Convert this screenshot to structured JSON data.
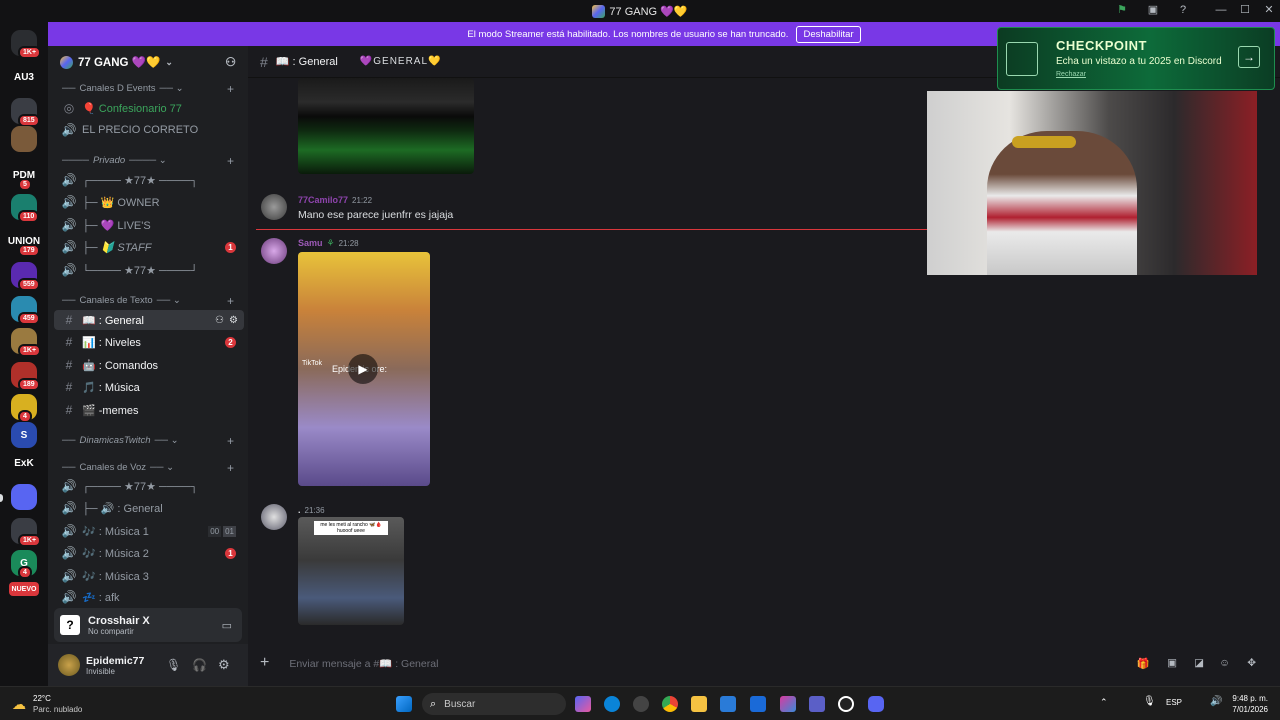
{
  "window": {
    "title": "77 GANG 💜💛"
  },
  "banner": {
    "text": "El modo Streamer está habilitado. Los nombres de usuario se han truncado.",
    "button": "Deshabilitar"
  },
  "servers": [
    {
      "label": "",
      "badge": "1K+",
      "color": "#2b2d31"
    },
    {
      "label": "AU3",
      "badge": "",
      "color": "#121214"
    },
    {
      "label": "",
      "badge": "815",
      "color": "#3a3d44"
    },
    {
      "label": "",
      "badge": "",
      "color": "#7a5a3a"
    },
    {
      "label": "PDM",
      "badge": "5",
      "color": "#121214"
    },
    {
      "label": "",
      "badge": "110",
      "color": "#1a7f6e"
    },
    {
      "label": "UNION",
      "badge": "179",
      "color": "#121214"
    },
    {
      "label": "",
      "badge": "559",
      "color": "#5a2ab0"
    },
    {
      "label": "",
      "badge": "459",
      "color": "#2a8bb0"
    },
    {
      "label": "",
      "badge": "1K+",
      "color": "#9a7a40"
    },
    {
      "label": "",
      "badge": "189",
      "color": "#b0302a"
    },
    {
      "label": "",
      "badge": "4",
      "color": "#d8b020"
    },
    {
      "label": "S",
      "badge": "",
      "color": "#2a4bb0"
    },
    {
      "label": "ExK",
      "badge": "",
      "color": "#121214"
    },
    {
      "label": "",
      "badge": "",
      "color": "#5865f2"
    },
    {
      "label": "",
      "badge": "1K+",
      "color": "#3a3d44"
    },
    {
      "label": "G",
      "badge": "4",
      "color": "#1a8a5a"
    },
    {
      "label": "NUEVO",
      "badge": "",
      "color": "#da373c"
    }
  ],
  "sidebar": {
    "server_name": "77 GANG 💜💛",
    "categories": [
      "Canales D Events",
      "Privado",
      "Canales de Texto",
      "DinamicasTwitch",
      "Canales de Voz"
    ],
    "channels": [
      {
        "icon": "◎",
        "label": "🎈 Confesionario 77",
        "badge": ""
      },
      {
        "icon": "🔊",
        "label": "EL PRECIO CORRETO",
        "badge": ""
      },
      {
        "icon": "🔊",
        "label": "┌──── ★77★ ────┐",
        "badge": ""
      },
      {
        "icon": "🔊",
        "label": "├─ 👑 OWNER",
        "badge": ""
      },
      {
        "icon": "🔊",
        "label": "├─ 💜 LIVE'S",
        "badge": ""
      },
      {
        "icon": "🔊",
        "label": "├─ 🔰 STAFF",
        "badge": "1"
      },
      {
        "icon": "🔊",
        "label": "└──── ★77★ ────┘",
        "badge": ""
      },
      {
        "icon": "#",
        "label": "📖 : General",
        "badge": ""
      },
      {
        "icon": "#",
        "label": "📊 : Niveles",
        "badge": "2"
      },
      {
        "icon": "#",
        "label": "🤖 : Comandos",
        "badge": ""
      },
      {
        "icon": "#",
        "label": "🎵 : Música",
        "badge": ""
      },
      {
        "icon": "#",
        "label": "🎬 -memes",
        "badge": ""
      },
      {
        "icon": "🔊",
        "label": "┌──── ★77★ ────┐",
        "badge": ""
      },
      {
        "icon": "🔊",
        "label": "├─ 🔊 : General",
        "badge": ""
      },
      {
        "icon": "🔊",
        "label": "🎶 : Música 1",
        "badge": ""
      },
      {
        "icon": "🔊",
        "label": "🎶 : Música 2",
        "badge": "1"
      },
      {
        "icon": "🔊",
        "label": "🎶 : Música 3",
        "badge": ""
      },
      {
        "icon": "🔊",
        "label": "💤 : afk",
        "badge": ""
      }
    ],
    "musica1_counts": [
      "00",
      "01"
    ],
    "crosshair": {
      "name": "Crosshair X",
      "status": "No compartir"
    },
    "user": {
      "name": "Epidemic77",
      "status": "Invisible"
    }
  },
  "chat": {
    "channel": "📖 : General",
    "topic": "💜GENERAL💛",
    "messages": [
      {
        "author": "77Camilo77",
        "time": "21:22",
        "text": "Mano ese parece juenfrr es jajaja",
        "color": "#8e44ad"
      },
      {
        "author": "Samu",
        "time": "21:28",
        "text": "",
        "video_caption": "Epidemic ore:",
        "tiktok": "TikTok",
        "color": "#9b59b6"
      },
      {
        "author": ".",
        "time": "21:36",
        "text": "",
        "meme_caption": "me les meti al rancho 🦋🩸 huooof ueee",
        "color": "#dbdee1"
      }
    ],
    "input_placeholder": "Enviar mensaje a #📖 : General"
  },
  "overlay": {
    "title": "CHECKPOINT",
    "subtitle": "Echa un vistazo a tu 2025 en Discord",
    "dismiss": "Rechazar"
  },
  "taskbar": {
    "temp": "22°C",
    "weather": "Parc. nublado",
    "search": "Buscar",
    "lang": "ESP",
    "time": "9:48 p. m.",
    "date": "7/01/2026"
  }
}
